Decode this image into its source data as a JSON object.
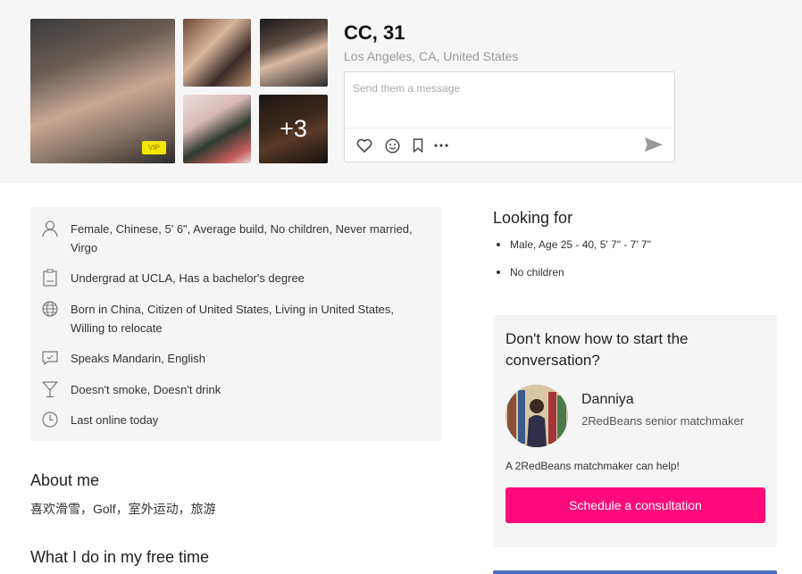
{
  "profile": {
    "name": "CC, 31",
    "location": "Los Angeles, CA, United States",
    "vip_badge": "VIP",
    "more_photos": "+3"
  },
  "message": {
    "placeholder": "Send them a message"
  },
  "icons": {
    "like": "heart-icon",
    "emoji": "smile-icon",
    "save": "bookmark-icon",
    "more": "more-icon",
    "send": "send-icon"
  },
  "info": [
    {
      "icon": "person-icon",
      "text": "Female, Chinese, 5' 6\", Average build, No children, Never married, Virgo"
    },
    {
      "icon": "diploma-icon",
      "text": "Undergrad at UCLA, Has a bachelor's degree"
    },
    {
      "icon": "globe-icon",
      "text": "Born in China, Citizen of United States, Living in United States, Willing to relocate"
    },
    {
      "icon": "speech-icon",
      "text": "Speaks Mandarin, English"
    },
    {
      "icon": "cocktail-icon",
      "text": "Doesn't smoke, Doesn't drink"
    },
    {
      "icon": "clock-icon",
      "text": "Last online today"
    }
  ],
  "about": {
    "title": "About me",
    "text": "喜欢滑雪，Golf，室外运动，旅游"
  },
  "free_time": {
    "title": "What I do in my free time"
  },
  "looking_for": {
    "title": "Looking for",
    "items": [
      "Male, Age 25 - 40, 5' 7\" - 7' 7\"",
      "No children"
    ]
  },
  "matchmaker": {
    "question": "Don't know how to start the conversation?",
    "name": "Danniya",
    "role": "2RedBeans senior matchmaker",
    "help": "A 2RedBeans matchmaker can help!",
    "button": "Schedule a consultation"
  },
  "colors": {
    "accent": "#ff0a7a",
    "vip": "#f5e600"
  }
}
